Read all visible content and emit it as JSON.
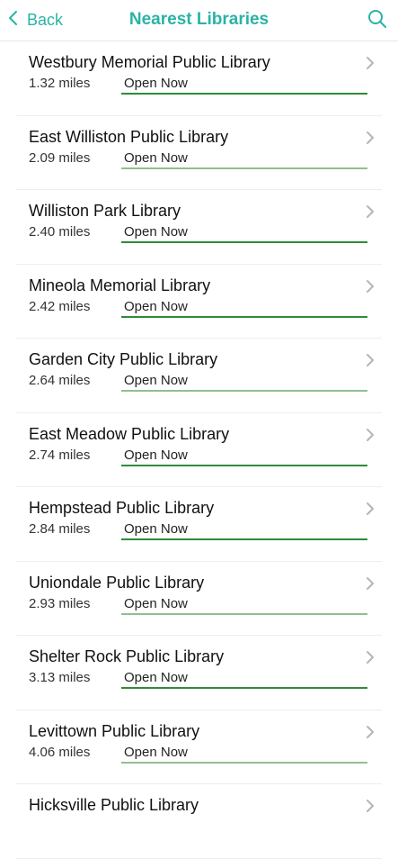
{
  "header": {
    "back_label": "Back",
    "title": "Nearest Libraries"
  },
  "colors": {
    "accent": "#29b3a6",
    "status_bar_bright": "#2e8b3a",
    "status_bar_muted": "#8fbf93"
  },
  "libraries": [
    {
      "name": "Westbury Memorial Public Library",
      "distance": "1.32 miles",
      "status": "Open Now",
      "bar": "bright"
    },
    {
      "name": "East Williston Public Library",
      "distance": "2.09 miles",
      "status": "Open Now",
      "bar": "muted"
    },
    {
      "name": "Williston Park Library",
      "distance": "2.40 miles",
      "status": "Open Now",
      "bar": "bright"
    },
    {
      "name": "Mineola Memorial Library",
      "distance": "2.42 miles",
      "status": "Open Now",
      "bar": "bright"
    },
    {
      "name": "Garden City Public Library",
      "distance": "2.64 miles",
      "status": "Open Now",
      "bar": "muted"
    },
    {
      "name": "East Meadow Public Library",
      "distance": "2.74 miles",
      "status": "Open Now",
      "bar": "bright"
    },
    {
      "name": "Hempstead Public Library",
      "distance": "2.84 miles",
      "status": "Open Now",
      "bar": "bright"
    },
    {
      "name": "Uniondale Public Library",
      "distance": "2.93 miles",
      "status": "Open Now",
      "bar": "muted"
    },
    {
      "name": "Shelter Rock Public Library",
      "distance": "3.13 miles",
      "status": "Open Now",
      "bar": "bright"
    },
    {
      "name": "Levittown Public Library",
      "distance": "4.06 miles",
      "status": "Open Now",
      "bar": "muted"
    },
    {
      "name": "Hicksville Public Library",
      "distance": "",
      "status": "",
      "bar": ""
    }
  ]
}
